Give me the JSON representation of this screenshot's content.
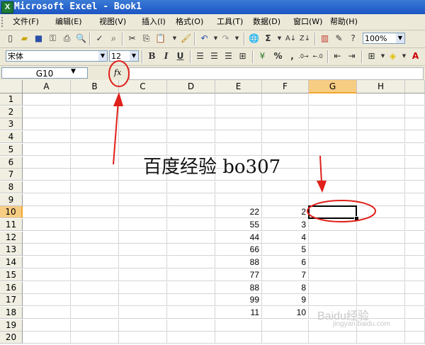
{
  "window": {
    "title": "Microsoft Excel - Book1",
    "app_icon": "excel-icon"
  },
  "menu": [
    "文件(F)",
    "编辑(E)",
    "视图(V)",
    "插入(I)",
    "格式(O)",
    "工具(T)",
    "数据(D)",
    "窗口(W)",
    "帮助(H)"
  ],
  "toolbar": {
    "zoom": "100%",
    "font_name": "宋体",
    "font_size": "12",
    "bold": "B",
    "italic": "I",
    "underline": "U",
    "percent": "%",
    "comma": ",",
    "sigma": "Σ"
  },
  "formula_bar": {
    "name_box": "G10",
    "fx_label": "fx",
    "content": ""
  },
  "sheet": {
    "columns": [
      "A",
      "B",
      "C",
      "D",
      "E",
      "F",
      "G",
      "H"
    ],
    "rows": [
      "1",
      "2",
      "3",
      "4",
      "5",
      "6",
      "7",
      "8",
      "9",
      "10",
      "11",
      "12",
      "13",
      "14",
      "15",
      "16",
      "17",
      "18",
      "19",
      "20"
    ],
    "selected_column": "G",
    "selected_row": "10",
    "column_e_values": [
      "22",
      "55",
      "44",
      "66",
      "88",
      "77",
      "88",
      "99",
      "11"
    ],
    "column_f_values": [
      "2",
      "3",
      "4",
      "5",
      "6",
      "7",
      "8",
      "9",
      "10"
    ]
  },
  "overlay": {
    "caption": "百度经验 bo307",
    "watermark": "Baidu经验",
    "watermark_sub": "jingyan.baidu.com"
  },
  "colors": {
    "annotation": "#e0201a",
    "selection_header": "#f7cd84",
    "title_bar": "#1c54c4"
  }
}
